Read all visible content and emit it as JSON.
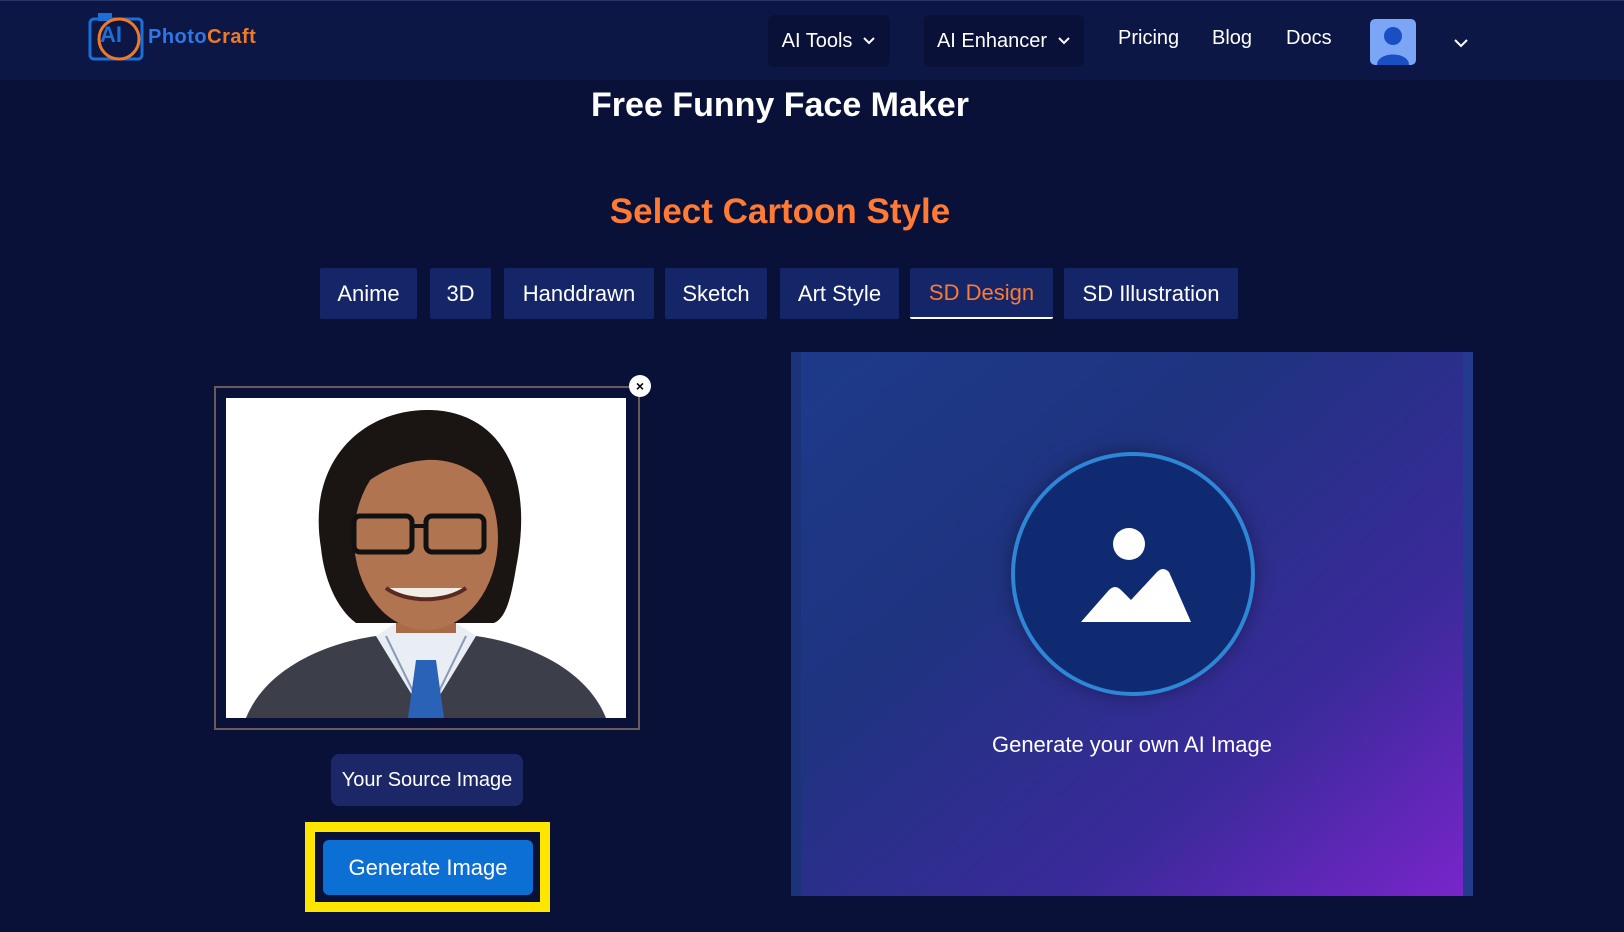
{
  "header": {
    "logo_ai": "AI",
    "logo_word_a": "Photo",
    "logo_word_b": "Craft",
    "nav_dropdowns": [
      {
        "label": "AI Tools"
      },
      {
        "label": "AI Enhancer"
      }
    ],
    "nav_links": [
      {
        "label": "Pricing"
      },
      {
        "label": "Blog"
      },
      {
        "label": "Docs"
      }
    ],
    "avatar_icon": "user-icon"
  },
  "page": {
    "title": "Free Funny Face Maker",
    "section_title": "Select Cartoon Style"
  },
  "style_tabs": [
    {
      "label": "Anime",
      "active": false
    },
    {
      "label": "3D",
      "active": false
    },
    {
      "label": "Handdrawn",
      "active": false
    },
    {
      "label": "Sketch",
      "active": false
    },
    {
      "label": "Art Style",
      "active": false
    },
    {
      "label": "SD Design",
      "active": true
    },
    {
      "label": "SD Illustration",
      "active": false
    }
  ],
  "source": {
    "close_symbol": "×",
    "label": "Your Source Image",
    "generate_button": "Generate Image"
  },
  "output": {
    "icon": "image-placeholder-icon",
    "caption": "Generate your own AI Image"
  },
  "colors": {
    "background": "#0a1138",
    "nav": "#0d1745",
    "accent_orange": "#ff7a33",
    "tab": "#142568",
    "button_blue": "#0b6fd3",
    "highlight": "#ffe600"
  }
}
